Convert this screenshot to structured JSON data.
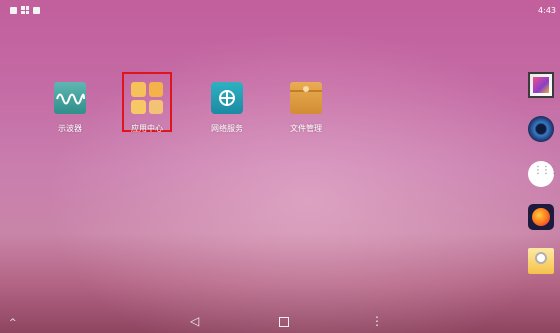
{
  "status_bar": {
    "time": "4:43",
    "icons": [
      "notification-icon",
      "grid-notification-icon",
      "square-notification-icon"
    ]
  },
  "desktop": {
    "apps": [
      {
        "label": "示波器",
        "icon": "oscilloscope-icon"
      },
      {
        "label": "应用中心",
        "icon": "app-center-icon"
      },
      {
        "label": "网络服务",
        "icon": "network-service-icon"
      },
      {
        "label": "文件管理",
        "icon": "file-manager-icon"
      }
    ],
    "highlighted_app": "应用中心"
  },
  "dock": {
    "items": [
      "gallery-icon",
      "music-player-icon",
      "app-drawer-icon",
      "firefox-icon",
      "mail-icon"
    ]
  },
  "nav_bar": {
    "up": "^",
    "back": "◁",
    "menu": "⋮"
  },
  "colors": {
    "highlight": "#e0141b",
    "wallpaper_top": "#c25f9c",
    "wallpaper_bottom": "#8e4560"
  }
}
